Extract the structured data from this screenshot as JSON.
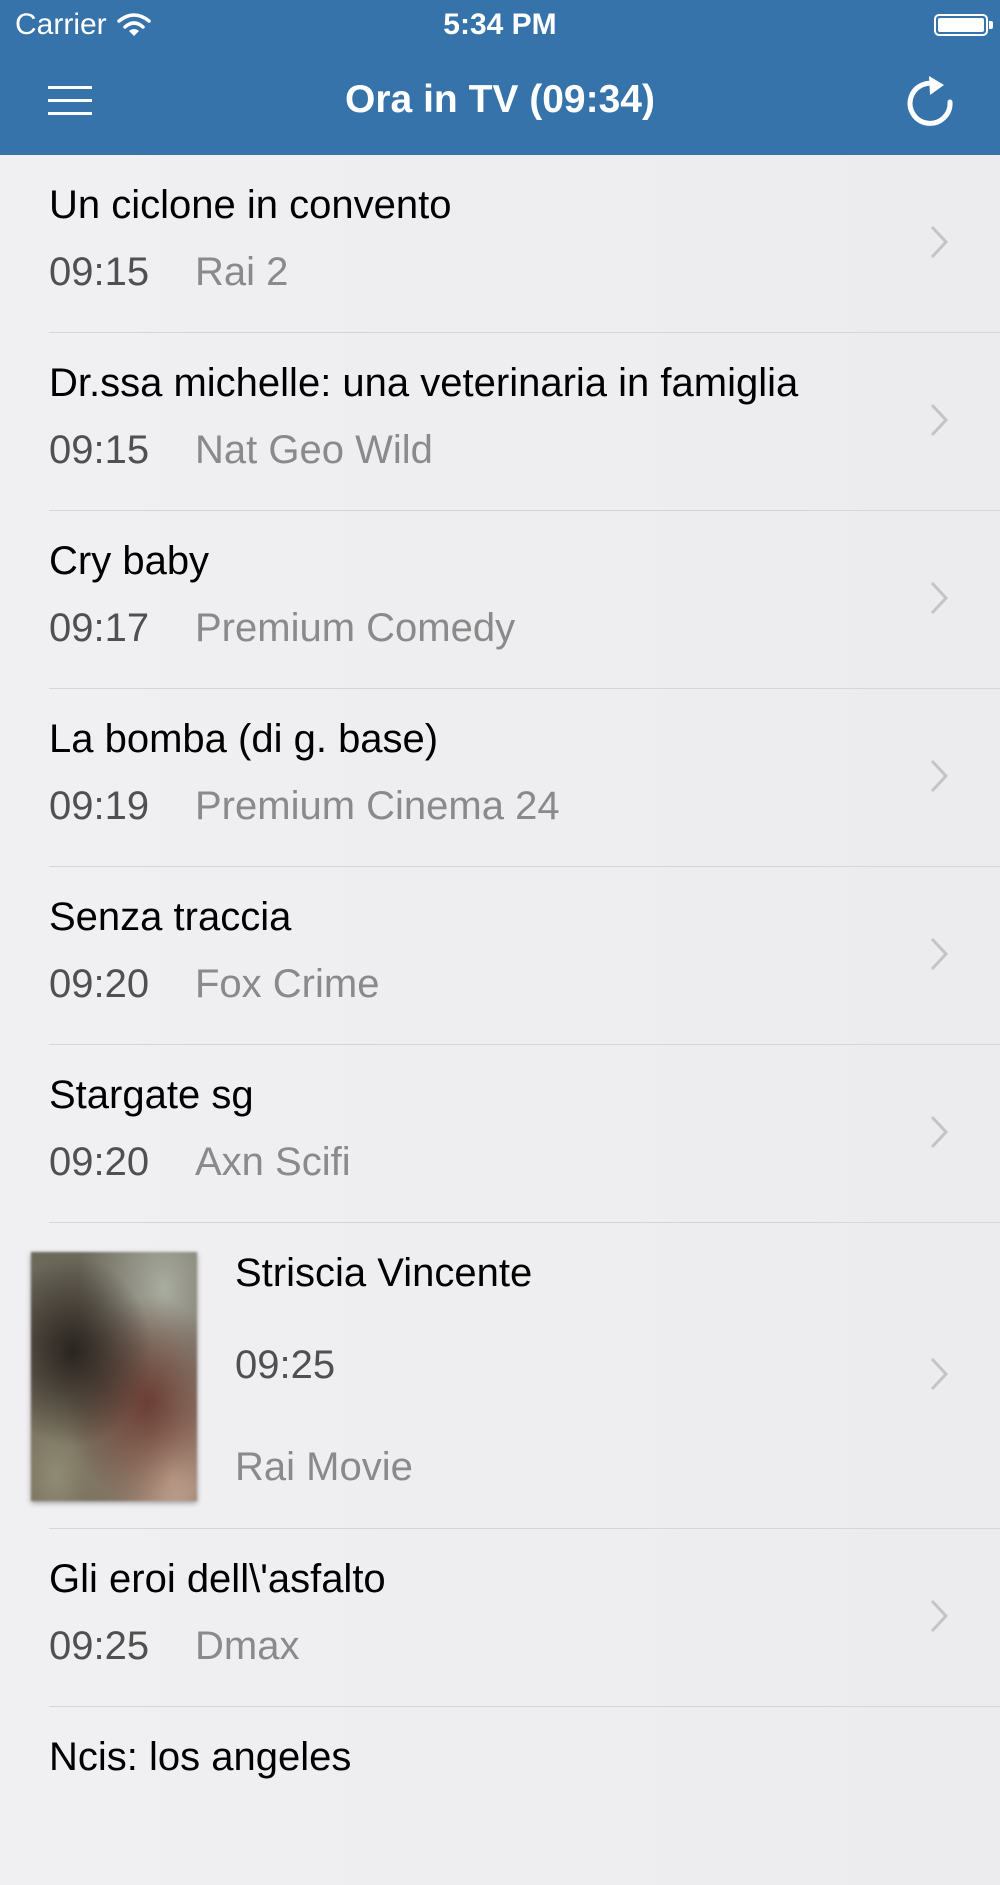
{
  "status_bar": {
    "carrier": "Carrier",
    "time": "5:34 PM",
    "battery_level": 1.0
  },
  "nav": {
    "title": "Ora in TV (09:34)",
    "menu_icon": "hamburger-menu-icon",
    "refresh_icon": "refresh-icon"
  },
  "colors": {
    "nav_background": "#3573aa",
    "list_background": "#efeff4"
  },
  "programs": [
    {
      "title": "Un ciclone in convento",
      "time": "09:15",
      "channel": "Rai 2"
    },
    {
      "title": "Dr.ssa michelle: una veterinaria in famiglia",
      "time": "09:15",
      "channel": "Nat Geo Wild"
    },
    {
      "title": "Cry baby",
      "time": "09:17",
      "channel": "Premium Comedy"
    },
    {
      "title": "La bomba (di g. base)",
      "time": "09:19",
      "channel": "Premium Cinema 24"
    },
    {
      "title": "Senza traccia",
      "time": "09:20",
      "channel": "Fox Crime"
    },
    {
      "title": "Stargate sg",
      "time": "09:20",
      "channel": "Axn Scifi"
    },
    {
      "title": "Striscia Vincente",
      "time": "09:25",
      "channel": "Rai Movie"
    },
    {
      "title": "Gli eroi dell\\'asfalto",
      "time": "09:25",
      "channel": "Dmax"
    },
    {
      "title": "Ncis: los angeles",
      "time": "",
      "channel": ""
    }
  ]
}
